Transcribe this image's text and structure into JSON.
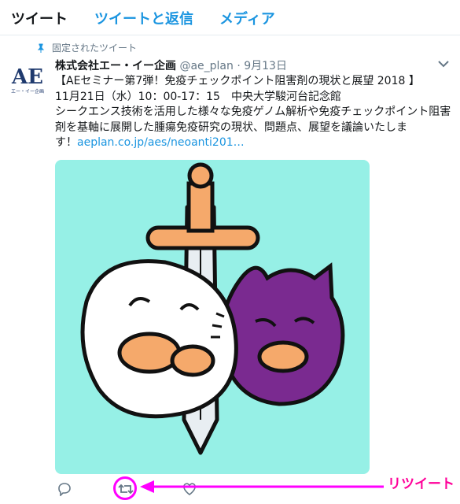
{
  "tabs": {
    "tweets": "ツイート",
    "tweets_replies": "ツイートと返信",
    "media": "メディア"
  },
  "pinned": {
    "label": "固定されたツイート",
    "icon": "pin-icon"
  },
  "tweet": {
    "avatar_text": "AE",
    "avatar_caption": "エー・イー企画",
    "name": "株式会社エー・イー企画",
    "handle": "@ae_plan",
    "separator": "·",
    "date": "9月13日",
    "lines": [
      "【AEセミナー第7弾！免疫チェックポイント阻害剤の現状と展望 2018 】",
      "11月21日（水）10：00-17：15　中央大学駿河台記念館",
      "シークエンス技術を活用した様々な免疫ゲノム解析や免疫チェックポイント阻害",
      "剤を基軸に展開した腫瘍免疫研究の現状、問題点、展望を議論いたしま"
    ],
    "last_line_prefix": "す！",
    "link": "aeplan.co.jp/aes/neoanti201…"
  },
  "actions": {
    "reply_icon": "reply-icon",
    "retweet_icon": "retweet-icon",
    "like_icon": "heart-icon"
  },
  "annotation": {
    "label": "リツイート",
    "color": "#ff00ff"
  },
  "colors": {
    "link": "#1b95e0",
    "media_bg": "#96f0e6",
    "purple": "#7a2a90"
  }
}
